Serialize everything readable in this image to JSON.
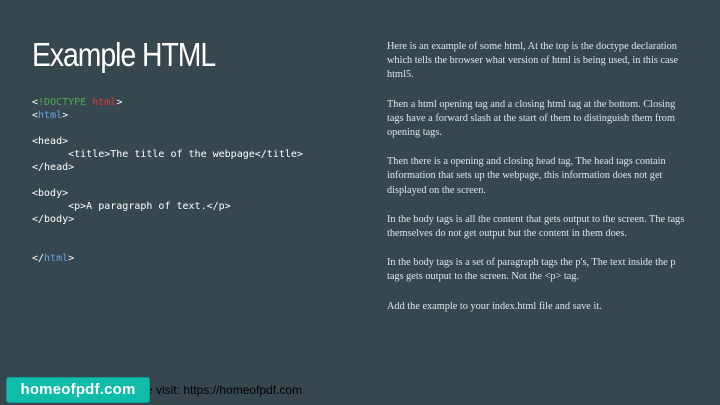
{
  "slide": {
    "title": "Example HTML",
    "code_lines": [
      {
        "parts": [
          {
            "t": "<",
            "c": "plain"
          },
          {
            "t": "!DOCTYPE",
            "c": "green"
          },
          {
            "t": " ",
            "c": "plain"
          },
          {
            "t": "html",
            "c": "red"
          },
          {
            "t": ">",
            "c": "plain"
          }
        ]
      },
      {
        "parts": [
          {
            "t": "<",
            "c": "plain"
          },
          {
            "t": "html",
            "c": "blue"
          },
          {
            "t": ">",
            "c": "plain"
          }
        ]
      },
      {
        "parts": []
      },
      {
        "parts": [
          {
            "t": "<head>",
            "c": "plain"
          }
        ]
      },
      {
        "parts": [
          {
            "t": "      <title>The title of the webpage</title>",
            "c": "plain"
          }
        ]
      },
      {
        "parts": [
          {
            "t": "</head>",
            "c": "plain"
          }
        ]
      },
      {
        "parts": []
      },
      {
        "parts": [
          {
            "t": "<body>",
            "c": "plain"
          }
        ]
      },
      {
        "parts": [
          {
            "t": "      <p>A paragraph of text.</p>",
            "c": "plain"
          }
        ]
      },
      {
        "parts": [
          {
            "t": "</body>",
            "c": "plain"
          }
        ]
      },
      {
        "parts": []
      },
      {
        "parts": []
      },
      {
        "parts": [
          {
            "t": "</",
            "c": "plain"
          },
          {
            "t": "html",
            "c": "blue"
          },
          {
            "t": ">",
            "c": "plain"
          }
        ]
      }
    ],
    "paragraphs": [
      "Here is an example of some html, At the top is the doctype declaration which tells the browser what version of html is being used, in this case html5.",
      "Then a html opening tag and a closing html tag at the bottom. Closing tags have a forward slash at the start of them to distinguish them from opening tags.",
      "Then there is a opening and closing head tag, The head tags contain information that sets up the webpage, this information does not get displayed on the screen.",
      "In the body tags is all the content that gets output to the screen. The tags themselves do not get output but the content in them does.",
      "In the body tags is a set of paragraph tags the p's, The text inside the p tags gets output to the screen. Not the <p> tag.",
      "Add the example to your index.html file and save it."
    ]
  },
  "footer": {
    "visit_text": "se visit: https://homeofpdf.com",
    "badge_label": "homeofpdf.com"
  },
  "colors": {
    "background": "#37474f",
    "badge": "#0fbcaa",
    "code_green": "#4caf50",
    "code_red": "#e53935",
    "code_blue": "#6ba3e0"
  }
}
